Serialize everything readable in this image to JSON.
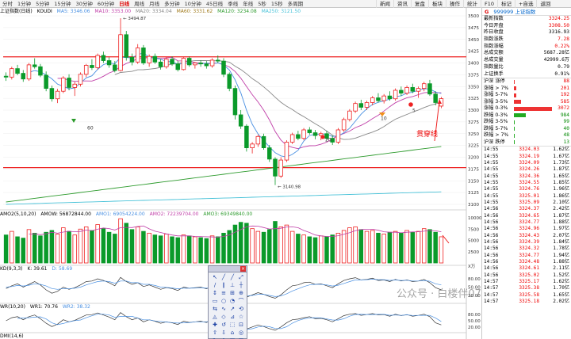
{
  "toolbar": {
    "periods": [
      "分时",
      "1分钟",
      "5分钟",
      "15分钟",
      "30分钟",
      "60分钟",
      "日线",
      "周线",
      "月线",
      "多分钟",
      "10分钟",
      "45日线",
      "季线",
      "年线",
      "5秒",
      "15秒",
      "多周期"
    ],
    "active_period": "日线",
    "right_tabs": [
      "新闻",
      "资讯",
      "复盘",
      "板块",
      "操作",
      "统计",
      "F10",
      "标记",
      "+自选",
      "返回"
    ]
  },
  "main_info": {
    "name": "上证指数(日线)",
    "code": "KOUDI",
    "ma5": "MA5: 3346.06",
    "ma10": "MA10: 3353.00",
    "ma20": "MA20: 3334.04",
    "ma60": "MA60: 3331.62",
    "ma120": "MA120: 3234.08",
    "ma250": "MA250: 3121.50"
  },
  "main_axis": {
    "ticks": [
      "3500",
      "3475",
      "3450",
      "3425",
      "3400",
      "3375",
      "3350",
      "3325",
      "3300",
      "3275",
      "3250",
      "3225",
      "3200",
      "3175",
      "3150",
      "3125",
      "3100"
    ],
    "high_label": "3494.87",
    "low_label": "3140.98",
    "markers": [
      "60",
      "20",
      "10",
      "5"
    ]
  },
  "annotation": {
    "text": "贯穿线"
  },
  "volume_info": {
    "title": "AMO2(5,10,20)",
    "amow": "AMOW: 56872844.00",
    "amo1": "AMO1: 69054224.00",
    "amo2": "AMO2: 72239704.00",
    "amo3": "AMO3: 69349840.00",
    "unit": "X万",
    "ticks": [
      "10000",
      "7500",
      "5000",
      "2500"
    ]
  },
  "kdj_info": {
    "title": "KD(9,3,3)",
    "k": "K: 39.61",
    "d": "D: 58.69",
    "ticks": [
      "80.00",
      "50.00",
      "20.00"
    ]
  },
  "wr_info": {
    "title": "WR(10,20)",
    "wr1": "WR1: 70.76",
    "wr2": "WR2: 38.32",
    "ticks": [
      "80.00",
      "50.00",
      "20.00"
    ]
  },
  "dmi_info": {
    "title": "DMI(14,6)"
  },
  "right_panel": {
    "header_code": "999999",
    "header_name": "上证指数",
    "header_flag": "G",
    "quotes": [
      {
        "k": "最新指数",
        "v": "3324.25",
        "c": "red"
      },
      {
        "k": "今日开盘",
        "v": "3308.50",
        "c": "red"
      },
      {
        "k": "昨日收盘",
        "v": "3316.93",
        "c": ""
      },
      {
        "k": "指数涨跌",
        "v": "7.28",
        "c": "red"
      },
      {
        "k": "指数涨幅",
        "v": "0.22%",
        "c": "red"
      },
      {
        "k": "总成交额",
        "v": "5687.28亿",
        "c": ""
      },
      {
        "k": "总成交量",
        "v": "42999.6万",
        "c": ""
      },
      {
        "k": "指数量比",
        "v": "0.79",
        "c": ""
      },
      {
        "k": "上证换手",
        "v": "0.91%",
        "c": ""
      }
    ],
    "breadth": [
      {
        "k": "沪深 涨停",
        "n": "88",
        "c": "red",
        "ratio": 0.03
      },
      {
        "k": "涨幅 > 7%",
        "n": "201",
        "c": "red",
        "ratio": 0.06
      },
      {
        "k": "涨幅 5-7%",
        "n": "192",
        "c": "red",
        "ratio": 0.06
      },
      {
        "k": "涨幅 3-5%",
        "n": "585",
        "c": "red",
        "ratio": 0.19
      },
      {
        "k": "涨幅 0-3%",
        "n": "3072",
        "c": "red",
        "ratio": 1.0
      },
      {
        "k": "跌幅 0-3%",
        "n": "984",
        "c": "green",
        "ratio": 0.32
      },
      {
        "k": "跌幅 3-5%",
        "n": "99",
        "c": "green",
        "ratio": 0.03
      },
      {
        "k": "跌幅 5-7%",
        "n": "40",
        "c": "green",
        "ratio": 0.013
      },
      {
        "k": "跌幅 > 7%",
        "n": "48",
        "c": "green",
        "ratio": 0.015
      },
      {
        "k": "沪深 跌停",
        "n": "13",
        "c": "green",
        "ratio": 0.004
      }
    ],
    "ticks": [
      {
        "t": "14:55",
        "p": "3324.03",
        "v": "1.62亿"
      },
      {
        "t": "14:55",
        "p": "3324.19",
        "v": "1.67亿"
      },
      {
        "t": "14:55",
        "p": "3324.09",
        "v": "1.73亿"
      },
      {
        "t": "14:55",
        "p": "3324.26",
        "v": "1.87亿"
      },
      {
        "t": "14:55",
        "p": "3324.36",
        "v": "1.65亿"
      },
      {
        "t": "14:55",
        "p": "3324.55",
        "v": "1.85亿"
      },
      {
        "t": "14:55",
        "p": "3324.76",
        "v": "1.96亿"
      },
      {
        "t": "14:55",
        "p": "3325.01",
        "v": "1.86亿"
      },
      {
        "t": "14:55",
        "p": "3325.09",
        "v": "2.10亿"
      },
      {
        "t": "14:56",
        "p": "3324.37",
        "v": "2.42亿"
      },
      {
        "t": "14:56",
        "p": "3324.65",
        "v": "1.87亿"
      },
      {
        "t": "14:56",
        "p": "3324.77",
        "v": "1.88亿"
      },
      {
        "t": "14:56",
        "p": "3324.96",
        "v": "1.97亿"
      },
      {
        "t": "14:56",
        "p": "3324.43",
        "v": "2.07亿"
      },
      {
        "t": "14:56",
        "p": "3324.39",
        "v": "1.84亿"
      },
      {
        "t": "14:56",
        "p": "3324.32",
        "v": "1.78亿"
      },
      {
        "t": "14:56",
        "p": "3324.77",
        "v": "1.94亿"
      },
      {
        "t": "14:56",
        "p": "3324.48",
        "v": "1.88亿"
      },
      {
        "t": "14:56",
        "p": "3324.61",
        "v": "2.11亿"
      },
      {
        "t": "14:56",
        "p": "3325.02",
        "v": "1.52亿"
      },
      {
        "t": "14:57",
        "p": "3325.17",
        "v": "1.62亿"
      },
      {
        "t": "14:57",
        "p": "3325.38",
        "v": "1.70亿"
      },
      {
        "t": "14:57",
        "p": "3325.58",
        "v": "1.65亿"
      },
      {
        "t": "14:57",
        "p": "3325.18",
        "v": "2.02亿"
      }
    ]
  },
  "watermark": "公众号 · 白楼伴07",
  "palette": {
    "tools": [
      "↖",
      "╱",
      "╱",
      "⤢",
      "∕",
      "∥",
      "⊥",
      "┼",
      "↕",
      "≡",
      "⊞",
      "⊕",
      "▭",
      "○",
      "◔",
      "⌒",
      "⇆",
      "∿",
      "↗",
      "⟲",
      "◬",
      "◇",
      "⊿",
      "☆",
      "✚",
      "↺",
      "⬚",
      "⊡",
      "⇧",
      "⇩",
      "⌂",
      "◎",
      "✎",
      "A",
      "▤",
      "▦"
    ]
  },
  "chart_data": {
    "type": "candlestick",
    "ylim": [
      3100,
      3500
    ],
    "resistance_level": 3413,
    "support_level": 3178,
    "candles": [
      [
        3372,
        3380,
        3362,
        3370
      ],
      [
        3370,
        3392,
        3365,
        3388
      ],
      [
        3388,
        3396,
        3374,
        3378
      ],
      [
        3378,
        3385,
        3360,
        3366
      ],
      [
        3366,
        3400,
        3362,
        3396
      ],
      [
        3396,
        3410,
        3388,
        3392
      ],
      [
        3392,
        3398,
        3370,
        3374
      ],
      [
        3374,
        3382,
        3340,
        3346
      ],
      [
        3346,
        3352,
        3318,
        3324
      ],
      [
        3324,
        3345,
        3315,
        3340
      ],
      [
        3340,
        3372,
        3336,
        3368
      ],
      [
        3368,
        3376,
        3342,
        3348
      ],
      [
        3348,
        3360,
        3330,
        3355
      ],
      [
        3355,
        3380,
        3350,
        3376
      ],
      [
        3376,
        3398,
        3370,
        3395
      ],
      [
        3395,
        3408,
        3385,
        3390
      ],
      [
        3390,
        3420,
        3386,
        3416
      ],
      [
        3416,
        3424,
        3400,
        3405
      ],
      [
        3405,
        3412,
        3390,
        3396
      ],
      [
        3396,
        3404,
        3380,
        3384
      ],
      [
        3384,
        3494.87,
        3382,
        3460
      ],
      [
        3460,
        3468,
        3405,
        3412
      ],
      [
        3412,
        3420,
        3395,
        3402
      ],
      [
        3402,
        3440,
        3398,
        3432
      ],
      [
        3432,
        3438,
        3396,
        3400
      ],
      [
        3400,
        3418,
        3392,
        3414
      ],
      [
        3414,
        3420,
        3398,
        3402
      ],
      [
        3402,
        3408,
        3386,
        3392
      ],
      [
        3392,
        3412,
        3388,
        3408
      ],
      [
        3408,
        3414,
        3394,
        3398
      ],
      [
        3398,
        3404,
        3382,
        3386
      ],
      [
        3386,
        3412,
        3384,
        3410
      ],
      [
        3410,
        3414,
        3392,
        3396
      ],
      [
        3396,
        3402,
        3388,
        3400
      ],
      [
        3400,
        3406,
        3392,
        3398
      ],
      [
        3398,
        3404,
        3388,
        3394
      ],
      [
        3394,
        3410,
        3390,
        3406
      ],
      [
        3406,
        3416,
        3400,
        3404
      ],
      [
        3404,
        3410,
        3370,
        3376
      ],
      [
        3376,
        3380,
        3340,
        3346
      ],
      [
        3346,
        3352,
        3280,
        3290
      ],
      [
        3290,
        3300,
        3260,
        3266
      ],
      [
        3266,
        3270,
        3212,
        3220
      ],
      [
        3220,
        3232,
        3208,
        3228
      ],
      [
        3228,
        3248,
        3222,
        3244
      ],
      [
        3244,
        3250,
        3216,
        3220
      ],
      [
        3220,
        3226,
        3190,
        3196
      ],
      [
        3196,
        3200,
        3140.98,
        3160
      ],
      [
        3160,
        3200,
        3156,
        3194
      ],
      [
        3194,
        3236,
        3190,
        3232
      ],
      [
        3232,
        3252,
        3228,
        3248
      ],
      [
        3248,
        3256,
        3236,
        3240
      ],
      [
        3240,
        3262,
        3236,
        3258
      ],
      [
        3258,
        3264,
        3248,
        3252
      ],
      [
        3252,
        3258,
        3238,
        3246
      ],
      [
        3246,
        3254,
        3236,
        3250
      ],
      [
        3250,
        3256,
        3236,
        3240
      ],
      [
        3240,
        3246,
        3226,
        3232
      ],
      [
        3232,
        3262,
        3228,
        3258
      ],
      [
        3258,
        3284,
        3254,
        3280
      ],
      [
        3280,
        3302,
        3276,
        3298
      ],
      [
        3298,
        3318,
        3294,
        3314
      ],
      [
        3314,
        3322,
        3300,
        3306
      ],
      [
        3306,
        3320,
        3300,
        3316
      ],
      [
        3316,
        3330,
        3310,
        3326
      ],
      [
        3326,
        3336,
        3316,
        3320
      ],
      [
        3320,
        3334,
        3314,
        3330
      ],
      [
        3330,
        3340,
        3320,
        3324
      ],
      [
        3324,
        3346,
        3320,
        3342
      ],
      [
        3342,
        3350,
        3330,
        3336
      ],
      [
        3336,
        3352,
        3332,
        3348
      ],
      [
        3348,
        3356,
        3336,
        3340
      ],
      [
        3340,
        3350,
        3326,
        3346
      ],
      [
        3346,
        3360,
        3340,
        3356
      ],
      [
        3356,
        3364,
        3330,
        3334
      ],
      [
        3334,
        3340,
        3310,
        3316
      ],
      [
        3308.5,
        3328,
        3304,
        3324.25
      ]
    ],
    "ma_series": [
      {
        "name": "MA5",
        "color": "#4a90e2"
      },
      {
        "name": "MA10",
        "color": "#c03fa8"
      },
      {
        "name": "MA20",
        "color": "#888888"
      },
      {
        "name": "MA120",
        "color": "#2e9b2e"
      },
      {
        "name": "MA250",
        "color": "#49c2d8"
      }
    ],
    "volume": [
      62,
      70,
      58,
      55,
      74,
      66,
      60,
      68,
      72,
      64,
      78,
      70,
      62,
      75,
      80,
      72,
      85,
      76,
      68,
      64,
      98,
      88,
      74,
      80,
      70,
      66,
      62,
      60,
      64,
      58,
      56,
      62,
      60,
      58,
      56,
      54,
      60,
      58,
      66,
      72,
      84,
      90,
      88,
      76,
      70,
      68,
      74,
      92,
      80,
      84,
      70,
      64,
      62,
      58,
      56,
      60,
      58,
      62,
      66,
      72,
      78,
      80,
      74,
      70,
      72,
      66,
      64,
      68,
      70,
      66,
      72,
      68,
      70,
      76,
      74,
      68,
      58
    ],
    "kdj_k": [
      45,
      55,
      62,
      50,
      60,
      70,
      58,
      40,
      28,
      35,
      50,
      42,
      48,
      58,
      70,
      72,
      80,
      74,
      66,
      55,
      85,
      70,
      60,
      66,
      52,
      58,
      50,
      42,
      48,
      45,
      38,
      50,
      46,
      48,
      50,
      44,
      54,
      52,
      36,
      24,
      15,
      12,
      14,
      22,
      30,
      24,
      16,
      10,
      22,
      40,
      55,
      58,
      66,
      68,
      60,
      62,
      55,
      48,
      62,
      74,
      80,
      84,
      76,
      78,
      82,
      74,
      76,
      70,
      78,
      72,
      76,
      70,
      72,
      78,
      66,
      48,
      40
    ],
    "kdj_d": [
      50,
      52,
      56,
      54,
      57,
      62,
      60,
      54,
      45,
      42,
      45,
      44,
      46,
      50,
      58,
      64,
      70,
      72,
      70,
      64,
      72,
      72,
      66,
      66,
      60,
      60,
      56,
      50,
      49,
      47,
      44,
      46,
      46,
      47,
      48,
      46,
      49,
      50,
      45,
      36,
      28,
      22,
      18,
      20,
      24,
      24,
      20,
      16,
      18,
      26,
      36,
      44,
      52,
      58,
      60,
      60,
      58,
      54,
      57,
      63,
      70,
      76,
      76,
      77,
      79,
      77,
      77,
      74,
      76,
      74,
      75,
      72,
      72,
      74,
      71,
      62,
      58
    ],
    "wr": [
      50,
      35,
      30,
      45,
      30,
      22,
      40,
      62,
      78,
      66,
      45,
      55,
      48,
      35,
      22,
      20,
      12,
      22,
      32,
      45,
      10,
      30,
      45,
      36,
      55,
      45,
      52,
      62,
      55,
      60,
      68,
      52,
      58,
      55,
      52,
      58,
      45,
      48,
      70,
      85,
      92,
      95,
      90,
      80,
      70,
      78,
      88,
      96,
      80,
      60,
      45,
      42,
      35,
      30,
      40,
      38,
      45,
      55,
      40,
      25,
      18,
      15,
      24,
      20,
      15,
      22,
      20,
      28,
      18,
      25,
      20,
      28,
      24,
      18,
      30,
      60,
      70
    ]
  }
}
